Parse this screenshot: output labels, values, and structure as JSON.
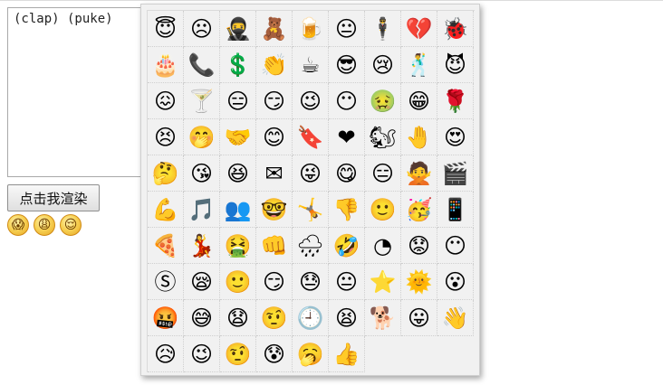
{
  "editor": {
    "value": "(clap) (puke)"
  },
  "render_button": {
    "label": "点击我渲染"
  },
  "rendered_emoticons": [
    {
      "icon": "clap-icon",
      "glyph": "😱"
    },
    {
      "icon": "puke-icon",
      "glyph": "😩"
    },
    {
      "icon": "blush-icon",
      "glyph": "😌"
    }
  ],
  "emoticon_panel": {
    "rows": [
      [
        {
          "icon": "angel-icon",
          "glyph": "😇"
        },
        {
          "icon": "sad-icon",
          "glyph": "☹"
        },
        {
          "icon": "ninja-icon",
          "glyph": "🥷"
        },
        {
          "icon": "bear-icon",
          "glyph": "🧸"
        },
        {
          "icon": "beer-icon",
          "glyph": "🍺"
        },
        {
          "icon": "bored-icon",
          "glyph": "😐"
        },
        {
          "icon": "gentleman-icon",
          "glyph": "🕴"
        },
        {
          "icon": "broken-heart-icon",
          "glyph": "💔"
        },
        {
          "icon": "bug-icon",
          "glyph": "🐞"
        }
      ],
      [
        {
          "icon": "cake-icon",
          "glyph": "🎂"
        },
        {
          "icon": "phone-call-icon",
          "glyph": "📞"
        },
        {
          "icon": "cash-icon",
          "glyph": "💲"
        },
        {
          "icon": "clap-icon",
          "glyph": "👏"
        },
        {
          "icon": "coffee-icon",
          "glyph": "☕"
        },
        {
          "icon": "cool-icon",
          "glyph": "😎"
        },
        {
          "icon": "cry-icon",
          "glyph": "😢"
        },
        {
          "icon": "dance-icon",
          "glyph": "🕺"
        },
        {
          "icon": "devil-icon",
          "glyph": "😈"
        }
      ],
      [
        {
          "icon": "doh-icon",
          "glyph": "😖"
        },
        {
          "icon": "drink-icon",
          "glyph": "🍸"
        },
        {
          "icon": "dull-icon",
          "glyph": "😑"
        },
        {
          "icon": "evil-grin-icon",
          "glyph": "😏"
        },
        {
          "icon": "flirt-icon",
          "glyph": "😉"
        },
        {
          "icon": "emo-icon",
          "glyph": "😶"
        },
        {
          "icon": "sick-icon",
          "glyph": "🤢"
        },
        {
          "icon": "grin-icon",
          "glyph": "😁"
        },
        {
          "icon": "flower-icon",
          "glyph": "🌹"
        }
      ],
      [
        {
          "icon": "headbang-icon",
          "glyph": "😣"
        },
        {
          "icon": "giggle-icon",
          "glyph": "🤭"
        },
        {
          "icon": "handshake-icon",
          "glyph": "🤝"
        },
        {
          "icon": "happy-icon",
          "glyph": "😊"
        },
        {
          "icon": "heidy-icon",
          "glyph": "🔖"
        },
        {
          "icon": "heart-icon",
          "glyph": "❤"
        },
        {
          "icon": "squirrel-icon",
          "glyph": "🐿"
        },
        {
          "icon": "wait-icon",
          "glyph": "🤚"
        },
        {
          "icon": "in-love-icon",
          "glyph": "😍"
        }
      ],
      [
        {
          "icon": "wonder-icon",
          "glyph": "🤔"
        },
        {
          "icon": "kiss-icon",
          "glyph": "😘"
        },
        {
          "icon": "laugh-icon",
          "glyph": "😆"
        },
        {
          "icon": "mail-icon",
          "glyph": "✉"
        },
        {
          "icon": "makeup-icon",
          "glyph": "😜"
        },
        {
          "icon": "mmm-icon",
          "glyph": "😋"
        },
        {
          "icon": "nerd-icon",
          "glyph": "😑"
        },
        {
          "icon": "no-icon",
          "glyph": "🙅"
        },
        {
          "icon": "movie-icon",
          "glyph": "🎬"
        }
      ],
      [
        {
          "icon": "muscle-icon",
          "glyph": "💪"
        },
        {
          "icon": "music-icon",
          "glyph": "🎵"
        },
        {
          "icon": "people-icon",
          "glyph": "👥"
        },
        {
          "icon": "nerd-glasses-icon",
          "glyph": "🤓"
        },
        {
          "icon": "ninja-dance-icon",
          "glyph": "🤸"
        },
        {
          "icon": "thumbs-down-icon",
          "glyph": "👎"
        },
        {
          "icon": "smile-icon",
          "glyph": "🙂"
        },
        {
          "icon": "party-icon",
          "glyph": "🥳"
        },
        {
          "icon": "mobile-phone-icon",
          "glyph": "📱"
        }
      ],
      [
        {
          "icon": "pizza-icon",
          "glyph": "🍕"
        },
        {
          "icon": "dancer-icon",
          "glyph": "💃"
        },
        {
          "icon": "puke-icon",
          "glyph": "🤮"
        },
        {
          "icon": "punch-icon",
          "glyph": "👊"
        },
        {
          "icon": "rain-icon",
          "glyph": "🌧"
        },
        {
          "icon": "rofl-icon",
          "glyph": "🤣"
        },
        {
          "icon": "clock-face-icon",
          "glyph": "◔"
        },
        {
          "icon": "worried-icon",
          "glyph": "😟"
        },
        {
          "icon": "speechless-icon",
          "glyph": "😶"
        }
      ],
      [
        {
          "icon": "skype-icon",
          "glyph": "Ⓢ"
        },
        {
          "icon": "sleepy-icon",
          "glyph": "😪"
        },
        {
          "icon": "square-smile-icon",
          "glyph": "🙂"
        },
        {
          "icon": "smirk-icon",
          "glyph": "😏"
        },
        {
          "icon": "sweat-icon",
          "glyph": "😓"
        },
        {
          "icon": "neutral-icon",
          "glyph": "😐"
        },
        {
          "icon": "star-icon",
          "glyph": "⭐"
        },
        {
          "icon": "sun-icon",
          "glyph": "🌞"
        },
        {
          "icon": "surprised-icon",
          "glyph": "😮"
        }
      ],
      [
        {
          "icon": "swear-icon",
          "glyph": "🤬"
        },
        {
          "icon": "sweating-icon",
          "glyph": "😅"
        },
        {
          "icon": "shocked-icon",
          "glyph": "😧"
        },
        {
          "icon": "think-icon",
          "glyph": "🤨"
        },
        {
          "icon": "time-icon",
          "glyph": "🕘"
        },
        {
          "icon": "tired-icon",
          "glyph": "😫"
        },
        {
          "icon": "toivo-icon",
          "glyph": "🐕"
        },
        {
          "icon": "tongue-out-icon",
          "glyph": "😛"
        },
        {
          "icon": "wave-icon",
          "glyph": "👋"
        }
      ],
      [
        {
          "icon": "whew-icon",
          "glyph": "😥"
        },
        {
          "icon": "wink-icon",
          "glyph": "😉"
        },
        {
          "icon": "doubt-icon",
          "glyph": "🤨"
        },
        {
          "icon": "worry-icon",
          "glyph": "😰"
        },
        {
          "icon": "yawn-icon",
          "glyph": "🥱"
        },
        {
          "icon": "thumbs-up-icon",
          "glyph": "👍"
        }
      ]
    ]
  }
}
